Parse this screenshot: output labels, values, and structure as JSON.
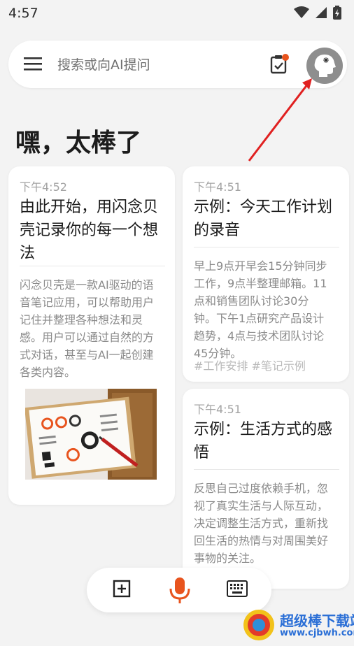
{
  "status_bar": {
    "time": "4:57"
  },
  "search": {
    "placeholder": "搜索或向AI提问"
  },
  "greeting": "嘿，太棒了",
  "notes": [
    {
      "time": "下午4:52",
      "title_lines": [
        "由此开始，用闪念贝",
        "壳记录你的每一个想",
        "法"
      ],
      "body_lines": [
        "闪念贝壳是一款AI驱动的语",
        "音笔记应用，可以帮助用户",
        "记住并整理各种想法和灵",
        "感。用户可以通过自然的方",
        "式对话，甚至与AI一起创建",
        "各类内容。"
      ]
    },
    {
      "time": "下午4:51",
      "title_lines": [
        "示例：今天工作计划",
        "的录音"
      ],
      "body_lines": [
        "早上9点开早会15分钟同步",
        "工作，9点半整理邮箱。11",
        "点和销售团队讨论30分",
        "钟。下午1点研究产品设计",
        "趋势，4点与技术团队讨论",
        "45分钟。"
      ],
      "tags": "#工作安排 #笔记示例"
    },
    {
      "time": "下午4:51",
      "title_lines": [
        "示例：生活方式的感",
        "悟"
      ],
      "body_lines": [
        "反思自己过度依赖手机，忽",
        "视了真实生活与人际互动，",
        "决定调整生活方式，重新找",
        "回生活的热情与对周围美好",
        "事物的关注。"
      ]
    }
  ],
  "watermark": {
    "title": "超级棒下载站",
    "url": "www.cjbwh.com"
  },
  "colors": {
    "accent": "#e8541e",
    "annotation_arrow": "#e02020",
    "mic": "#e8541e"
  }
}
